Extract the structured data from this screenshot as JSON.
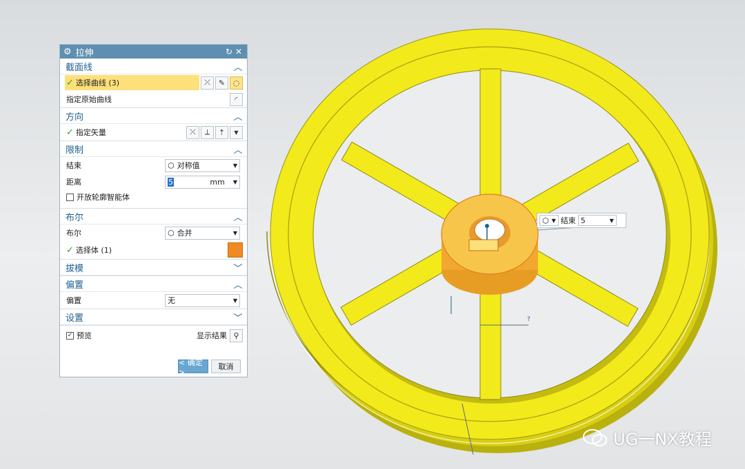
{
  "dialog": {
    "title": "拉伸",
    "section_section": {
      "title": "截面线",
      "select_curve": "选择曲线 (3)",
      "specify_origin": "指定原始曲线"
    },
    "section_direction": {
      "title": "方向",
      "specify_vector": "指定矢量"
    },
    "section_limits": {
      "title": "限制",
      "end_label": "结束",
      "end_value": "对称值",
      "distance_label": "距离",
      "distance_value": "5",
      "distance_unit": "mm",
      "open_profile": "开放轮廓智能体"
    },
    "section_boolean": {
      "title": "布尔",
      "boolean_label": "布尔",
      "boolean_value": "合并",
      "select_body": "选择体 (1)"
    },
    "section_draft": {
      "title": "拔模"
    },
    "section_offset": {
      "title": "偏置",
      "offset_label": "偏置",
      "offset_value": "无"
    },
    "section_settings": {
      "title": "设置"
    },
    "preview_label": "预览",
    "show_result": "显示结果",
    "ok_label": "< 确定 >",
    "cancel_label": "取消"
  },
  "onscreen": {
    "end_label": "结束",
    "end_value": "5",
    "dim_label": "?"
  },
  "watermark": {
    "text": "UG一NX教程"
  },
  "colors": {
    "title_bar": "#5e8fb0",
    "section_heading": "#1f5f8f",
    "highlight": "#fde07a",
    "model": "#f2ea1a",
    "hub": "#f5b336"
  }
}
